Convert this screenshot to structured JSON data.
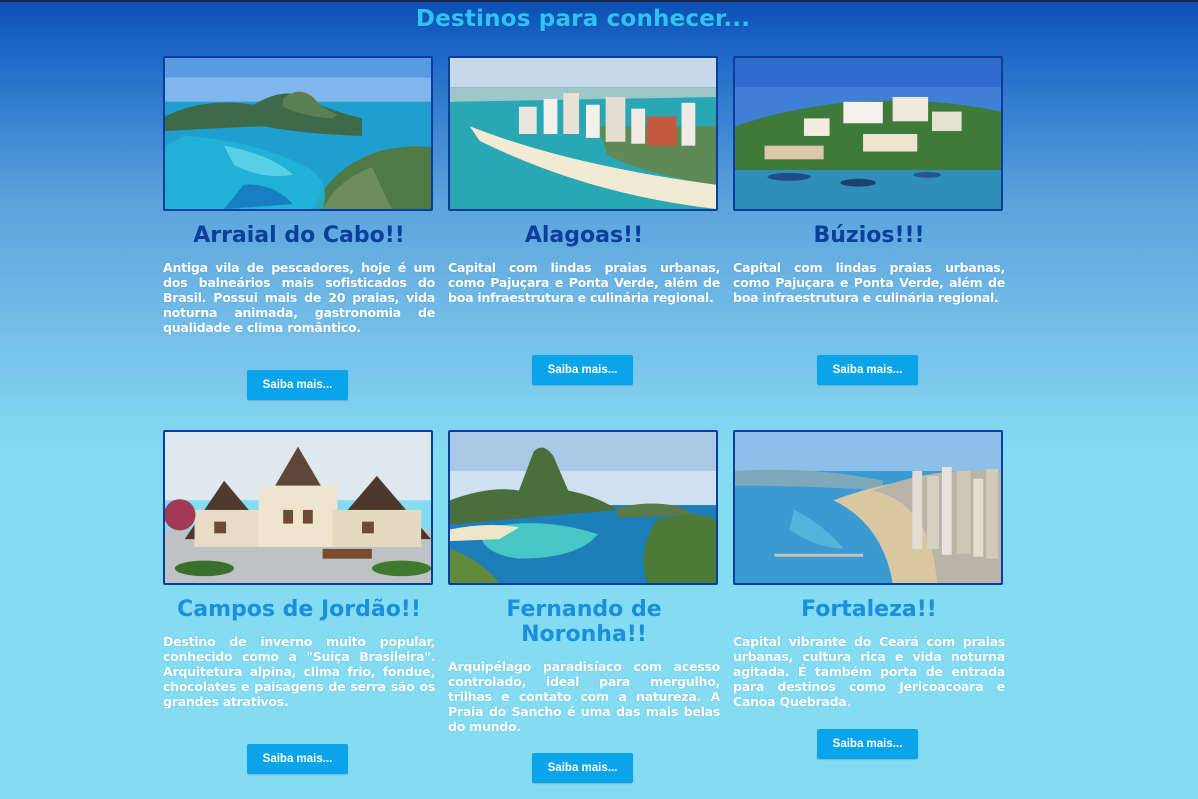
{
  "header": {
    "title": "Destinos para conhecer..."
  },
  "colors": {
    "accent": "#0aa4ea",
    "title_light": "#2ec4f2",
    "title_dark": "#0c3f9c"
  },
  "destinations": [
    {
      "title": "Arraial do Cabo!!",
      "description": "Antiga vila de pescadores, hoje é um dos balneários mais sofisticados do Brasil. Possui mais de 20 praias, vida noturna animada, gastronomia de qualidade e clima romântico.",
      "button": "Saiba mais..."
    },
    {
      "title": "Alagoas!!",
      "description": "Capital com lindas praias urbanas, como Pajuçara e Ponta Verde, além de boa infraestrutura e culinária regional.",
      "button": "Saiba mais..."
    },
    {
      "title": "Búzios!!!",
      "description": "Capital com lindas praias urbanas, como Pajuçara e Ponta Verde, além de boa infraestrutura e culinária regional.",
      "button": "Saiba mais..."
    },
    {
      "title": "Campos de Jordão!!",
      "description": "Destino de inverno muito popular, conhecido como a \"Suíça Brasileira\". Arquitetura alpina, clima frio, fondue, chocolates e paisagens de serra são os grandes atrativos.",
      "button": "Saiba mais..."
    },
    {
      "title": "Fernando de Noronha!!",
      "description": "Arquipélago paradisíaco com acesso controlado, ideal para mergulho, trilhas e contato com a natureza. A Praia do Sancho é uma das mais belas do mundo.",
      "button": "Saiba mais..."
    },
    {
      "title": "Fortaleza!!",
      "description": "Capital vibrante do Ceará com praias urbanas, cultura rica e vida noturna agitada. É também porta de entrada para destinos como Jericoacoara e Canoa Quebrada.",
      "button": "Saiba mais..."
    }
  ]
}
